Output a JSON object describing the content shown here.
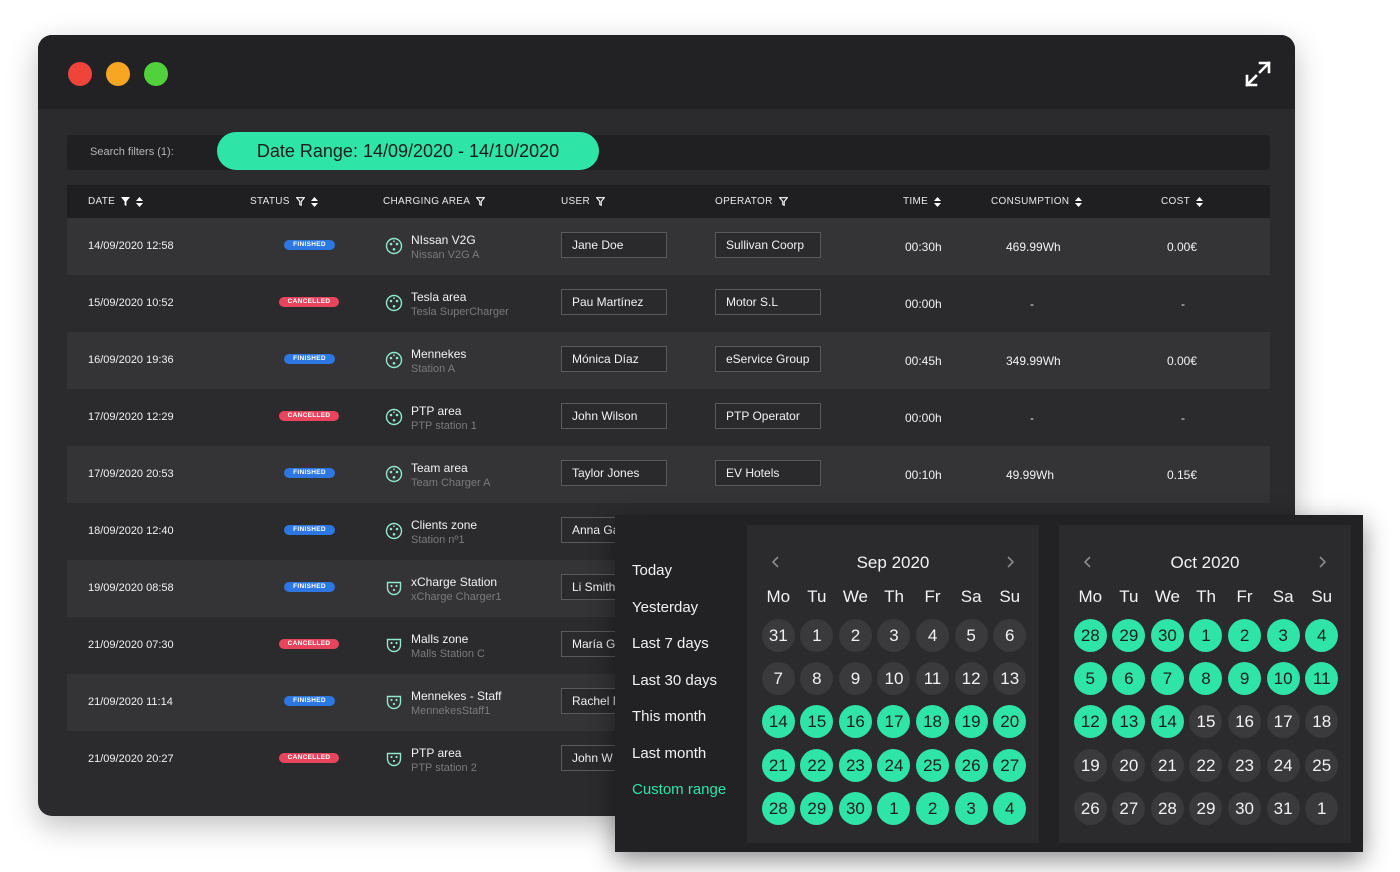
{
  "colors": {
    "accent": "#2fe4a7",
    "finished": "#2d77e3",
    "cancelled": "#e9445e",
    "window_bg": "#2b2b2d"
  },
  "window": {
    "expand_icon": "expand-arrows-icon"
  },
  "filters": {
    "label": "Search filters (1):",
    "pill": "Date Range: 14/09/2020 - 14/10/2020"
  },
  "table": {
    "headers": {
      "date": "DATE",
      "status": "STATUS",
      "area": "CHARGING AREA",
      "user": "USER",
      "operator": "OPERATOR",
      "time": "TIME",
      "consumption": "CONSUMPTION",
      "cost": "COST"
    },
    "rows": [
      {
        "date": "14/09/2020 12:58",
        "status": "FINISHED",
        "area": "NIssan V2G",
        "station": "Nissan V2G A",
        "user": "Jane Doe",
        "operator": "Sullivan Coorp",
        "time": "00:30h",
        "consumption": "469.99Wh",
        "cost": "0.00€"
      },
      {
        "date": "15/09/2020 10:52",
        "status": "CANCELLED",
        "area": "Tesla area",
        "station": "Tesla SuperCharger",
        "user": "Pau Martínez",
        "operator": "Motor S.L",
        "time": "00:00h",
        "consumption": "-",
        "cost": "-"
      },
      {
        "date": "16/09/2020 19:36",
        "status": "FINISHED",
        "area": "Mennekes",
        "station": "Station A",
        "user": "Mónica Díaz",
        "operator": "eService Group",
        "time": "00:45h",
        "consumption": "349.99Wh",
        "cost": "0.00€"
      },
      {
        "date": "17/09/2020 12:29",
        "status": "CANCELLED",
        "area": "PTP area",
        "station": "PTP station 1",
        "user": "John Wilson",
        "operator": "PTP Operator",
        "time": "00:00h",
        "consumption": "-",
        "cost": "-"
      },
      {
        "date": "17/09/2020 20:53",
        "status": "FINISHED",
        "area": "Team area",
        "station": "Team Charger A",
        "user": "Taylor Jones",
        "operator": "EV Hotels",
        "time": "00:10h",
        "consumption": "49.99Wh",
        "cost": "0.15€"
      },
      {
        "date": "18/09/2020 12:40",
        "status": "FINISHED",
        "area": "Clients zone",
        "station": "Station nº1",
        "user": "Anna Ga",
        "operator": "",
        "time": "",
        "consumption": "",
        "cost": ""
      },
      {
        "date": "19/09/2020 08:58",
        "status": "FINISHED",
        "area": "xCharge Station",
        "station": "xCharge Charger1",
        "user": "Li Smith",
        "operator": "",
        "time": "",
        "consumption": "",
        "cost": ""
      },
      {
        "date": "21/09/2020 07:30",
        "status": "CANCELLED",
        "area": "Malls zone",
        "station": "Malls Station C",
        "user": "María Go",
        "operator": "",
        "time": "",
        "consumption": "",
        "cost": ""
      },
      {
        "date": "21/09/2020 11:14",
        "status": "FINISHED",
        "area": "Mennekes - Staff",
        "station": "MennekesStaff1",
        "user": "Rachel M",
        "operator": "",
        "time": "",
        "consumption": "",
        "cost": ""
      },
      {
        "date": "21/09/2020 20:27",
        "status": "CANCELLED",
        "area": "PTP area",
        "station": "PTP station 2",
        "user": "John W",
        "operator": "",
        "time": "",
        "consumption": "",
        "cost": ""
      }
    ]
  },
  "picker": {
    "ranges": [
      "Today",
      "Yesterday",
      "Last 7 days",
      "Last 30 days",
      "This month",
      "Last month",
      "Custom range"
    ],
    "active_range": "Custom range",
    "weekdays": [
      "Mo",
      "Tu",
      "We",
      "Th",
      "Fr",
      "Sa",
      "Su"
    ],
    "months": [
      {
        "title": "Sep 2020",
        "days": [
          "31",
          "1",
          "2",
          "3",
          "4",
          "5",
          "6",
          "7",
          "8",
          "9",
          "10",
          "11",
          "12",
          "13",
          "14",
          "15",
          "16",
          "17",
          "18",
          "19",
          "20",
          "21",
          "22",
          "23",
          "24",
          "25",
          "26",
          "27",
          "28",
          "29",
          "30",
          "1",
          "2",
          "3",
          "4"
        ],
        "selected": [
          14,
          15,
          16,
          17,
          18,
          19,
          20,
          21,
          22,
          23,
          24,
          25,
          26,
          27,
          28,
          29,
          30,
          31,
          32,
          33,
          34
        ]
      },
      {
        "title": "Oct 2020",
        "days": [
          "28",
          "29",
          "30",
          "1",
          "2",
          "3",
          "4",
          "5",
          "6",
          "7",
          "8",
          "9",
          "10",
          "11",
          "12",
          "13",
          "14",
          "15",
          "16",
          "17",
          "18",
          "19",
          "20",
          "21",
          "22",
          "23",
          "24",
          "25",
          "26",
          "27",
          "28",
          "29",
          "30",
          "31",
          "1"
        ],
        "selected": [
          0,
          1,
          2,
          3,
          4,
          5,
          6,
          7,
          8,
          9,
          10,
          11,
          12,
          13,
          14,
          15,
          16
        ]
      }
    ]
  }
}
